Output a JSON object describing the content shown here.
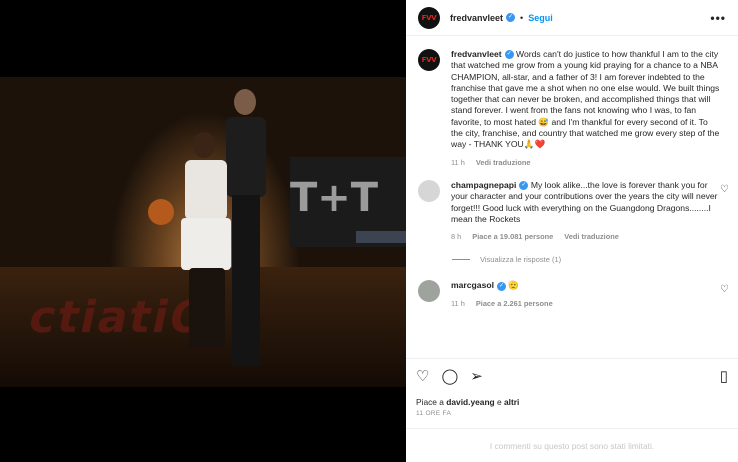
{
  "post": {
    "author": "fredvanvleet",
    "follow_label": "Segui",
    "separator": "•",
    "more_label": "•••",
    "avatar_text": "FVV"
  },
  "photo": {
    "court_text": "ctiatiO",
    "sign_text": "T+T"
  },
  "caption": {
    "username": "fredvanvleet",
    "text": "Words can't do justice to how thankful I am to the city that watched me grow from a young kid praying for a chance to a NBA CHAMPION, all-star, and a father of 3! I am forever indebted to the franchise that gave me a shot when no one else would. We built things together that can never be broken, and accomplished things that will stand forever. I went from the fans not knowing who I was, to fan favorite, to most hated 😅 and I'm thankful for every second of it. To the city, franchise, and country that watched me grow every step of the way - THANK YOU🙏❤️",
    "time": "11 h",
    "translate": "Vedi traduzione"
  },
  "comments": [
    {
      "username": "champagnepapi",
      "text": "My look alike...the love is forever thank you for your character and your contributions over the years the city will never forget!!! Good luck with everything on the Guangdong Dragons........I mean the Rockets",
      "time": "8 h",
      "likes": "Piace a 19.081 persone",
      "translate": "Vedi traduzione",
      "replies": "Visualizza le risposte (1)"
    },
    {
      "username": "marcgasol",
      "text": "🫡",
      "time": "11 h",
      "likes": "Piace a 2.261 persone"
    }
  ],
  "actions": {
    "like_icon": "heart-icon",
    "comment_icon": "comment-icon",
    "share_icon": "share-icon",
    "save_icon": "bookmark-icon"
  },
  "likes": {
    "prefix": "Piace a",
    "user": "david.yeang",
    "connector": "e",
    "others": "altri"
  },
  "date": "11 ORE FA",
  "limited_notice": "I commenti su questo post sono stati limitati."
}
